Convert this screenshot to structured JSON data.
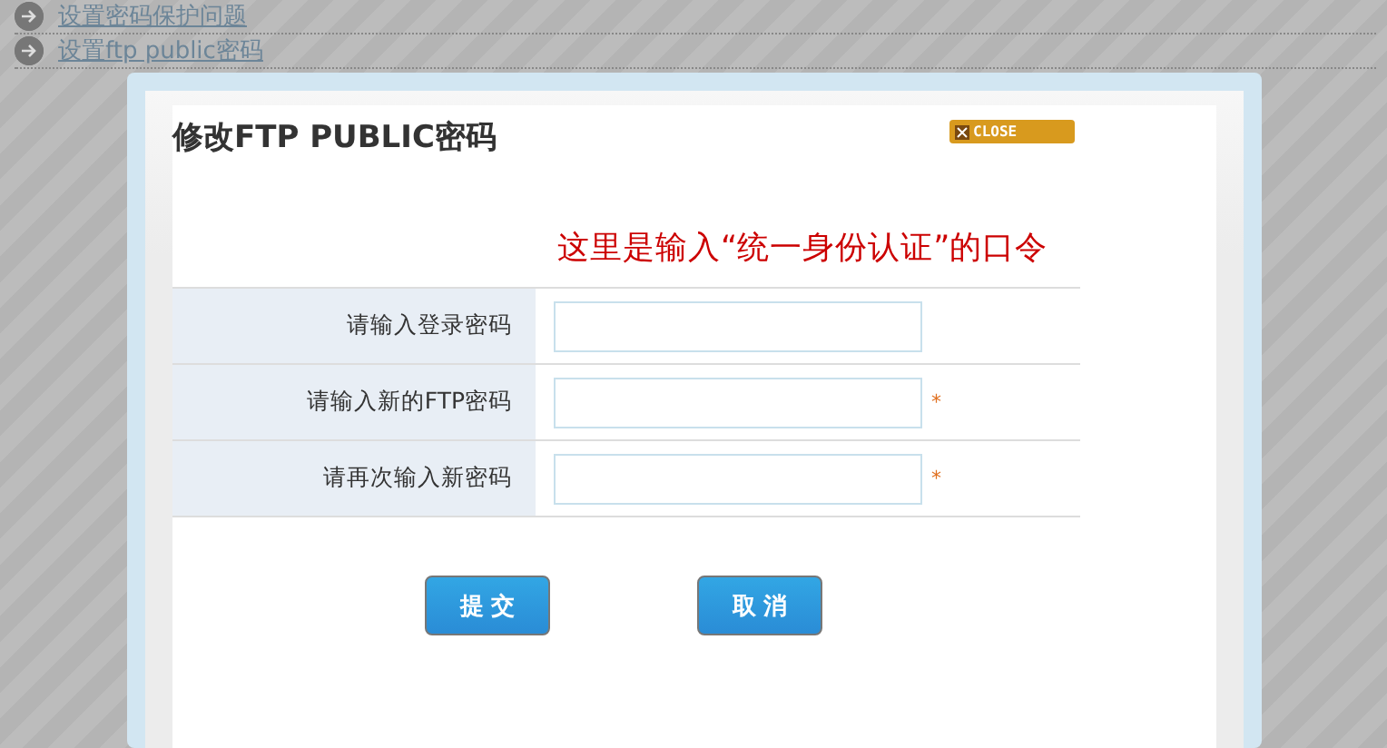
{
  "background_links": [
    {
      "label": "设置密码保护问题"
    },
    {
      "label": "设置ftp public密码"
    }
  ],
  "dialog": {
    "title": "修改FTP PUBLIC密码",
    "close_button": "CLOSE",
    "fields": [
      {
        "label": "请输入登录密码",
        "required": false
      },
      {
        "label": "请输入新的FTP密码",
        "required": true
      },
      {
        "label": "请再次输入新密码",
        "required": true
      }
    ],
    "required_mark": "*",
    "annotation": "这里是输入“统一身份认证”的口令",
    "buttons": [
      "提 交",
      "取 消"
    ]
  }
}
